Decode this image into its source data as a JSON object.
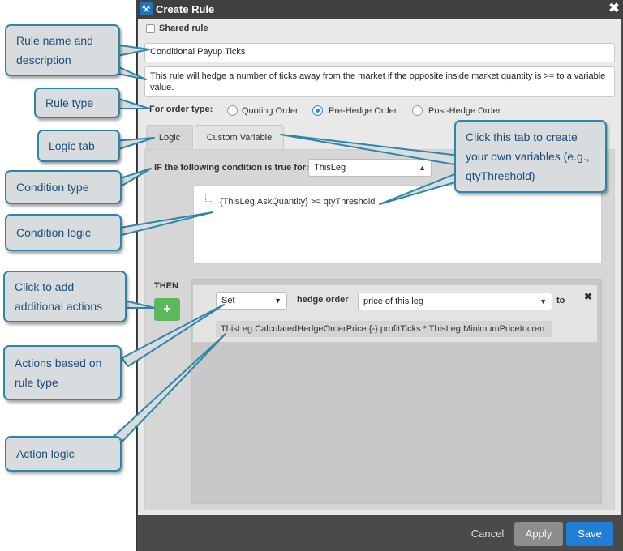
{
  "dialog": {
    "title": "Create Rule",
    "shared_rule_label": "Shared rule",
    "rule_name": "Conditional Payup Ticks",
    "description": "This rule will hedge a number of ticks away from the market if the opposite inside market quantity is >= to a variable value.",
    "order_type_label": "For order type:",
    "order_types": [
      "Quoting Order",
      "Pre-Hedge Order",
      "Post-Hedge Order"
    ],
    "selected_order_type": "Pre-Hedge Order",
    "tabs": [
      "Logic",
      "Custom Variable"
    ],
    "condition_label": "IF the following condition is true for:",
    "condition_target": "ThisLeg",
    "condition_logic": "{ThisLeg.AskQuantity} >= qtyThreshold",
    "then_label": "THEN",
    "action": {
      "verb": "Set",
      "object_label": "hedge order",
      "property": "price of this leg",
      "to_label": "to",
      "expression": "ThisLeg.CalculatedHedgeOrderPrice {-} profitTicks * ThisLeg.MinimumPriceIncren"
    },
    "buttons": {
      "cancel": "Cancel",
      "apply": "Apply",
      "save": "Save"
    }
  },
  "callouts": {
    "rule_name": "Rule name and description",
    "rule_type": "Rule type",
    "logic_tab": "Logic tab",
    "condition_type": "Condition type",
    "condition_logic": "Condition logic",
    "add_actions": "Click to add additional actions",
    "actions_type": "Actions based on rule type",
    "action_logic": "Action logic",
    "custom_tab": "Click this tab to create your own variables (e.g., qtyThreshold)"
  },
  "colors": {
    "accent": "#1f7ed8",
    "add_button": "#5cb85c",
    "callout_border": "#2d86a8",
    "callout_text": "#1b4e7a"
  }
}
